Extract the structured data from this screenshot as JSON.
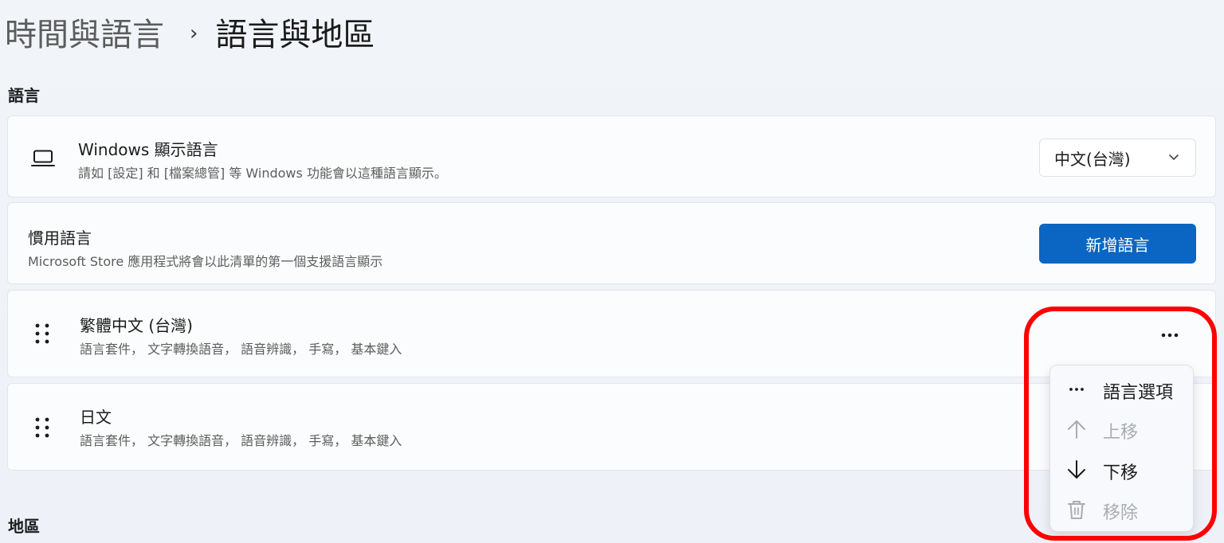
{
  "breadcrumb": {
    "parent": "時間與語言",
    "separator": "›",
    "current": "語言與地區"
  },
  "sections": {
    "language_label": "語言",
    "region_label": "地區"
  },
  "display_language": {
    "title": "Windows 顯示語言",
    "description": "請如 [設定] 和 [檔案總管] 等 Windows 功能會以這種語言顯示。",
    "icon": "laptop-icon",
    "selected_value": "中文(台灣)"
  },
  "preferred_languages": {
    "title": "慣用語言",
    "description": "Microsoft Store 應用程式將會以此清單的第一個支援語言顯示",
    "add_button_label": "新增語言",
    "button_color": "#0a66c2"
  },
  "languages": [
    {
      "name": "繁體中文 (台灣)",
      "features": "語言套件， 文字轉換語音， 語音辨識， 手寫， 基本鍵入"
    },
    {
      "name": "日文",
      "features": "語言套件， 文字轉換語音， 語音辨識， 手寫， 基本鍵入"
    }
  ],
  "context_menu": {
    "items": [
      {
        "label": "語言選項",
        "icon": "more-horizontal-icon",
        "enabled": true
      },
      {
        "label": "上移",
        "icon": "arrow-up-icon",
        "enabled": false
      },
      {
        "label": "下移",
        "icon": "arrow-down-icon",
        "enabled": true
      },
      {
        "label": "移除",
        "icon": "trash-icon",
        "enabled": false
      }
    ]
  },
  "highlight_color": "#ff0000"
}
